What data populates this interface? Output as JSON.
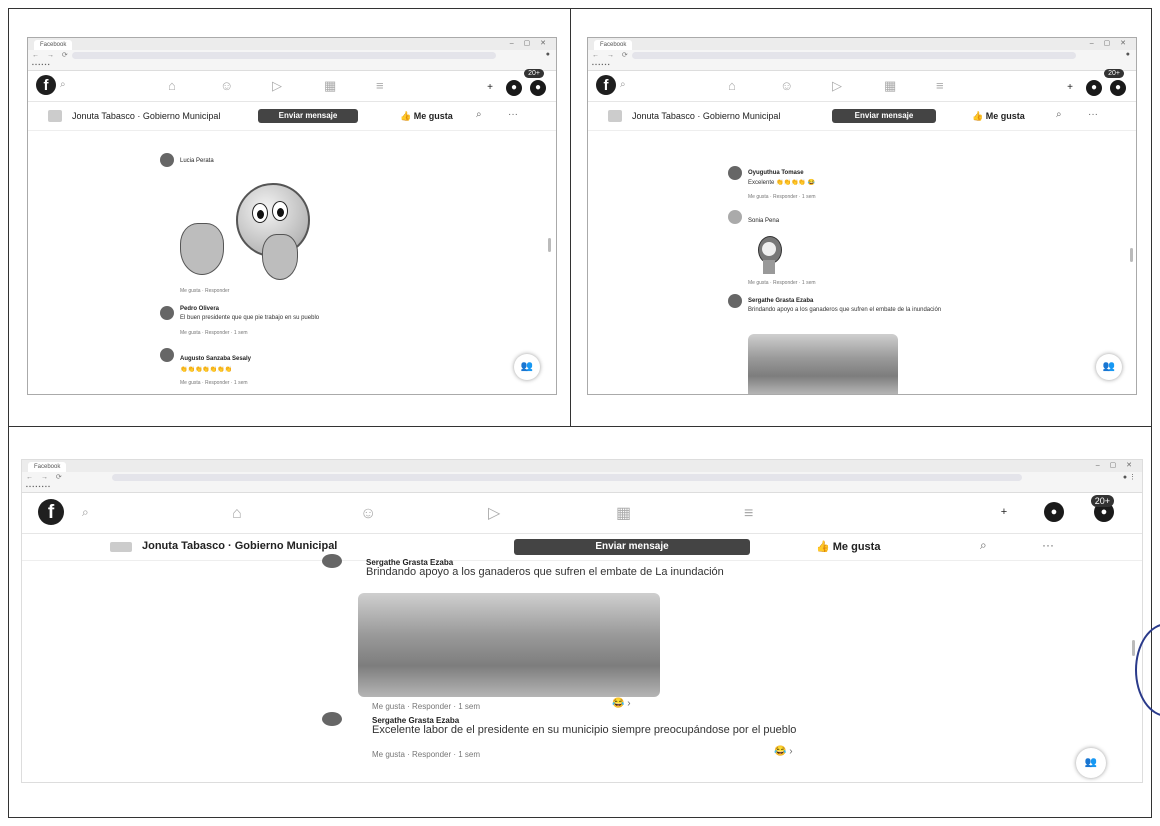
{
  "panels": {
    "top_left": {
      "badge": "20+",
      "page": {
        "name": "Jonuta Tabasco · Gobierno Municipal",
        "send_label": "Enviar mensaje",
        "like_label": "Me gusta"
      },
      "comments": [
        {
          "name": "Lucia Perata",
          "text": "",
          "meta": ""
        },
        {
          "name": "Pedro Olivera",
          "text": "El buen presidente que que pie trabajo en su pueblo",
          "meta": "Me gusta · Responder · 1 sem"
        },
        {
          "name": "Augusto Sanzaba Sesaly",
          "text": "👏👏👏👏👏👏👏",
          "meta": "Me gusta · Responder · 1 sem"
        }
      ]
    },
    "top_right": {
      "badge": "20+",
      "page": {
        "name": "Jonuta Tabasco · Gobierno Municipal",
        "send_label": "Enviar mensaje",
        "like_label": "Me gusta"
      },
      "comments": [
        {
          "name": "Oyuguthua Tomase",
          "text": "Excelente 👏👏👏👏 😂",
          "meta": "Me gusta · Responder · 1 sem"
        },
        {
          "name": "Sonia Pena",
          "text": "",
          "meta": "Me gusta · Responder · 1 sem"
        },
        {
          "name": "Sergathe Grasta Ezaba",
          "text": "Brindando apoyo a los ganaderos que sufren el embate de la inundación",
          "meta": ""
        }
      ]
    },
    "bottom": {
      "badge": "20+",
      "page": {
        "name": "Jonuta Tabasco · Gobierno Municipal",
        "send_label": "Enviar mensaje",
        "like_label": "Me gusta"
      },
      "comments": [
        {
          "name": "Sergathe Grasta Ezaba",
          "text": "Brindando apoyo a los ganaderos que sufren el embate de La inundación",
          "meta": ""
        },
        {
          "name": "Sergathe Grasta Ezaba",
          "text": "Excelente labor de el presidente en su municipio siempre preocupándose por el pueblo",
          "meta": "Me gusta · Responder · 1 sem"
        }
      ],
      "first_meta": "Me gusta · Responder · 1 sem"
    }
  }
}
